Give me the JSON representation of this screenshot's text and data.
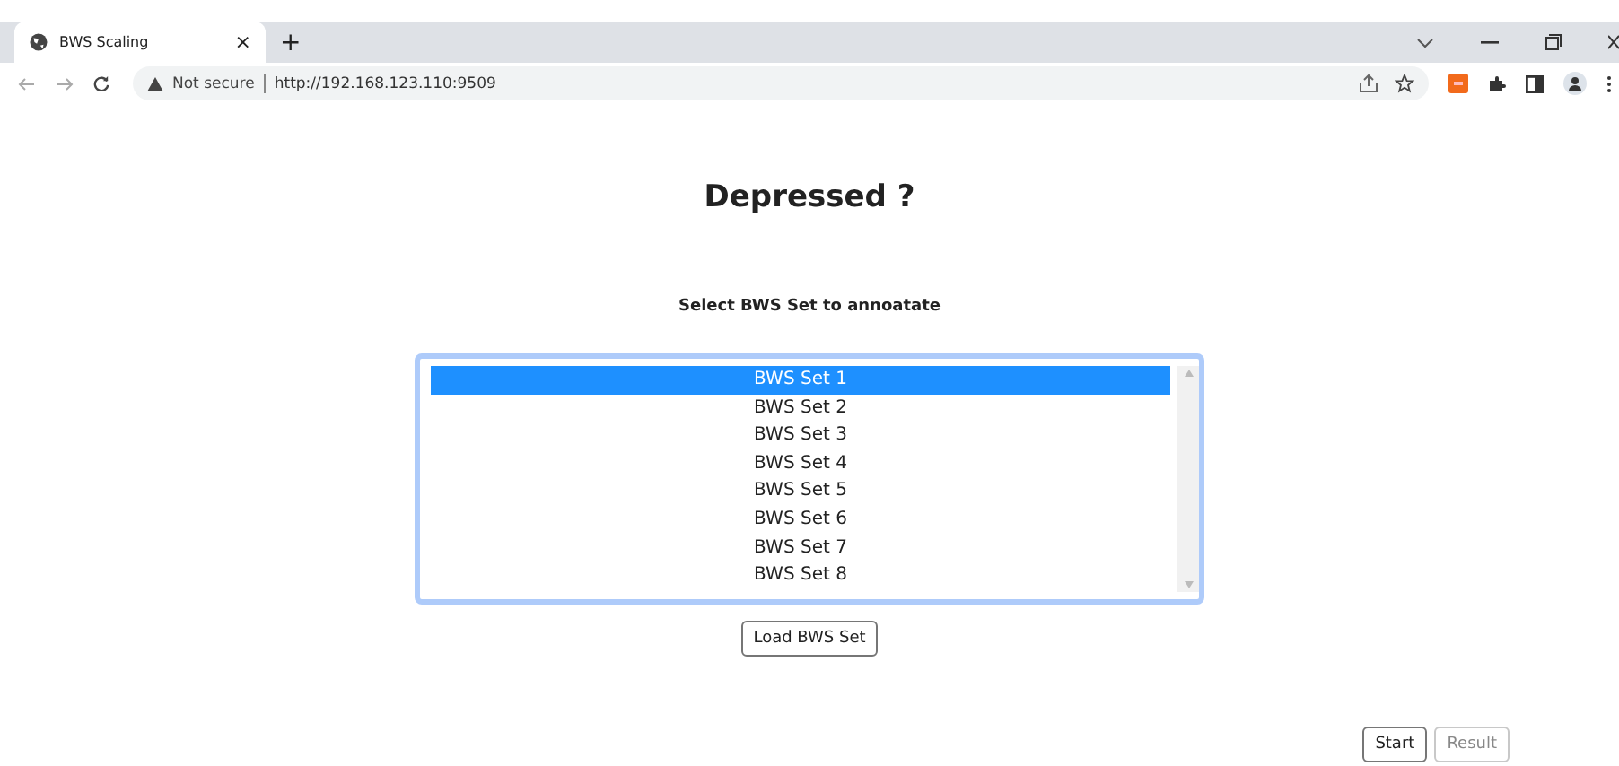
{
  "browser": {
    "tab_title": "BWS Scaling",
    "tab_close": "×",
    "new_tab": "+",
    "security": "Not secure",
    "url": "http://192.168.123.110:9509"
  },
  "page": {
    "heading": "Depressed ?",
    "prompt": "Select BWS Set to annoatate",
    "sets": [
      {
        "label": "BWS Set 1",
        "selected": true
      },
      {
        "label": "BWS Set 2",
        "selected": false
      },
      {
        "label": "BWS Set 3",
        "selected": false
      },
      {
        "label": "BWS Set 4",
        "selected": false
      },
      {
        "label": "BWS Set 5",
        "selected": false
      },
      {
        "label": "BWS Set 6",
        "selected": false
      },
      {
        "label": "BWS Set 7",
        "selected": false
      },
      {
        "label": "BWS Set 8",
        "selected": false
      }
    ],
    "load_button": "Load BWS Set",
    "buttons": [
      {
        "label": "Start",
        "disabled": false
      },
      {
        "label": "Result",
        "disabled": true
      }
    ]
  }
}
